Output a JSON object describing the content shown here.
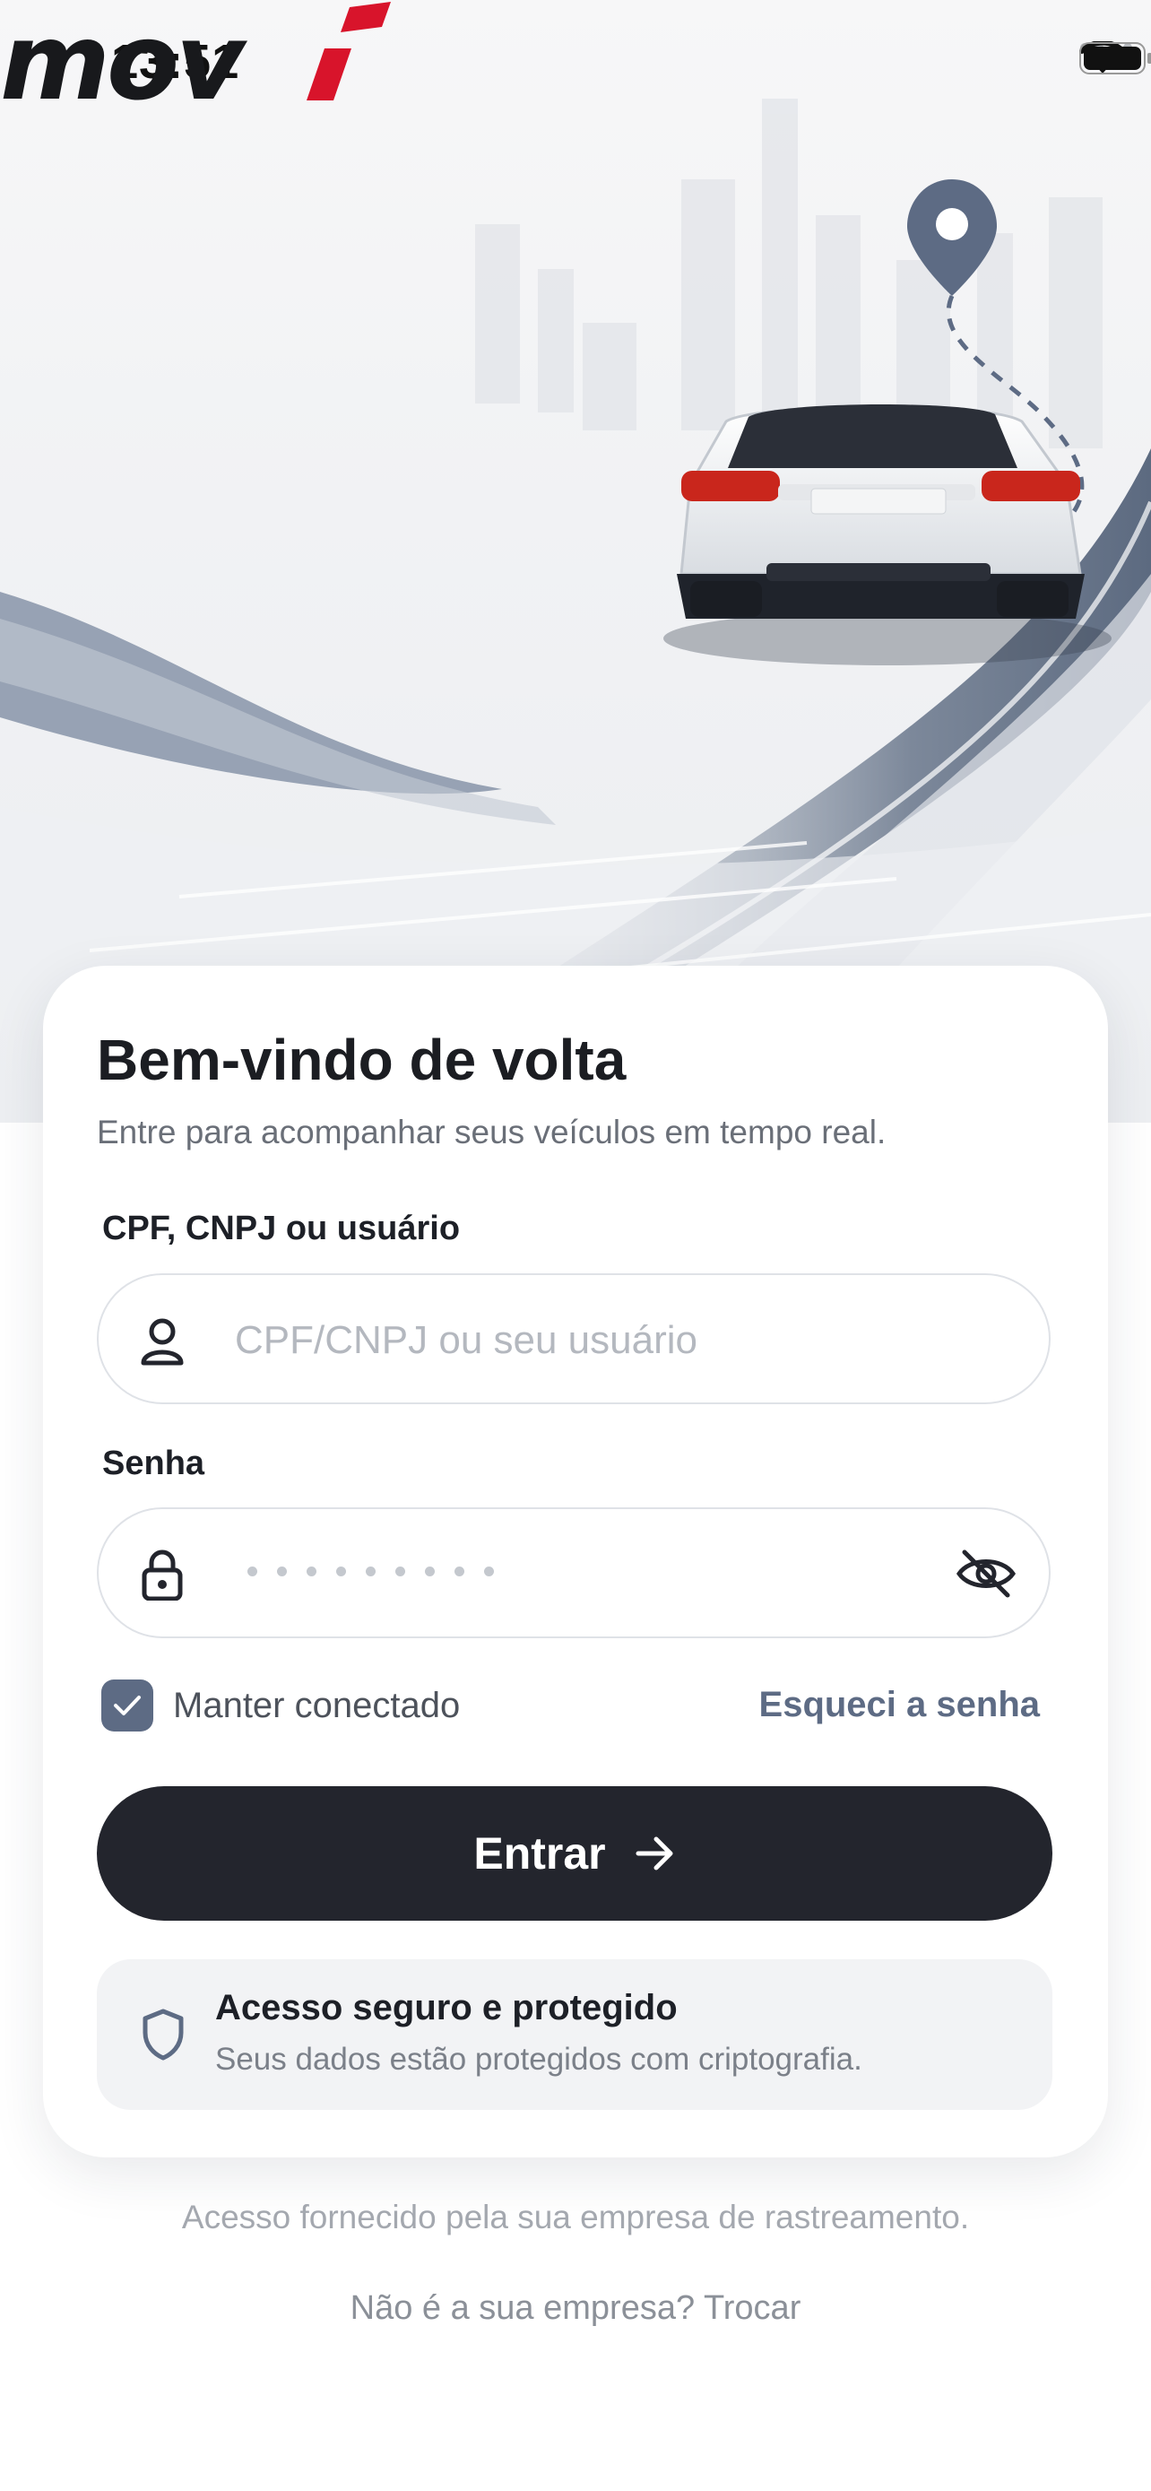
{
  "status_bar": {
    "time": "13:51"
  },
  "brand": {
    "logo_text": "movi",
    "accent_color": "#d8142b"
  },
  "login": {
    "title": "Bem-vindo de volta",
    "subtitle": "Entre para acompanhar seus veículos em tempo real.",
    "user_label": "CPF, CNPJ ou usuário",
    "user_placeholder": "CPF/CNPJ ou seu usuário",
    "password_label": "Senha",
    "keep_connected_label": "Manter conectado",
    "keep_connected_checked": true,
    "forgot_password": "Esqueci a senha",
    "submit_label": "Entrar"
  },
  "security_notice": {
    "title": "Acesso seguro e protegido",
    "text": "Seus dados estão protegidos com criptografia."
  },
  "footer": {
    "provider_text": "Acesso fornecido pela sua empresa de rastreamento.",
    "switch_company": "Não é a sua empresa? Trocar"
  },
  "colors": {
    "primary_dark": "#23252d",
    "secondary": "#5d6b84",
    "muted_text": "#6a6f78"
  }
}
